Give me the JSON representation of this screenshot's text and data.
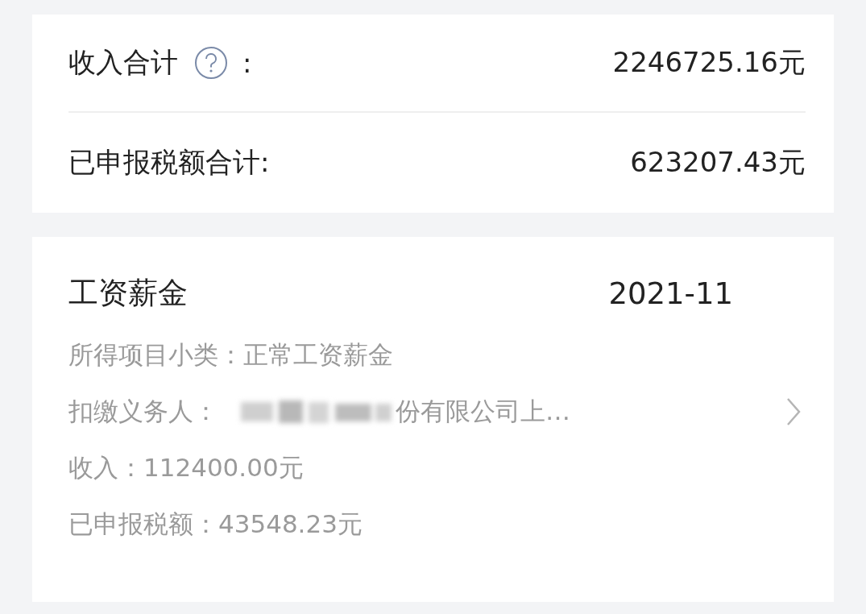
{
  "summary": [
    {
      "label": "收入合计",
      "help": true,
      "colon": ":",
      "value": "2246725.16元"
    },
    {
      "label": "已申报税额合计:",
      "help": false,
      "value": "623207.43元"
    }
  ],
  "record": {
    "title": "工资薪金",
    "period": "2021-11",
    "details": [
      {
        "kind": "text",
        "text": "所得项目小类：正常工资薪金"
      },
      {
        "kind": "redacted",
        "label": "扣缴义务人：",
        "text": "份有限公司上…"
      },
      {
        "kind": "text",
        "text": "收入：112400.00元"
      },
      {
        "kind": "text",
        "text": "已申报税额：43548.23元"
      }
    ]
  }
}
